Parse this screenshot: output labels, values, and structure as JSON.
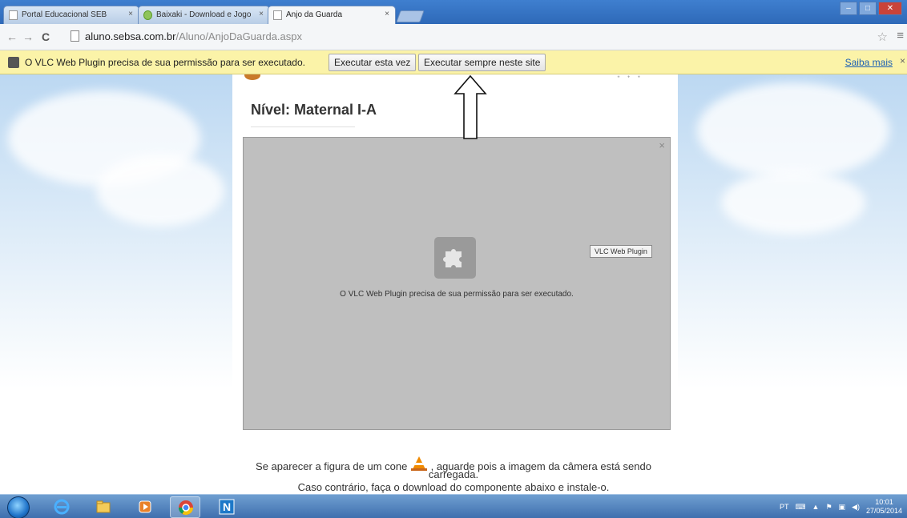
{
  "browser": {
    "tabs": [
      {
        "label": "Portal Educacional SEB",
        "active": false
      },
      {
        "label": "Baixaki - Download e Jogo",
        "active": false
      },
      {
        "label": "Anjo da Guarda",
        "active": true
      }
    ],
    "tab_close": "×",
    "url_host": "aluno.sebsa.com.br",
    "url_path": "/Aluno/AnjoDaGuarda.aspx"
  },
  "infobar": {
    "message": "O VLC Web Plugin precisa de sua permissão para ser executado.",
    "run_once_label": "Executar esta vez",
    "run_always_label": "Executar sempre neste site",
    "learn_more_label": "Saiba mais"
  },
  "page": {
    "level_title": "Nível: Maternal I-A",
    "plugin_tag": "VLC Web Plugin",
    "plugin_message": "O VLC Web Plugin precisa de sua permissão para ser executado.",
    "plugin_close": "×",
    "cone_text_before": "Se aparecer a figura de um cone",
    "cone_text_after": ", aguarde pois a imagem da câmera está sendo",
    "cone_text_line2": "carregada.",
    "download_text": "Caso contrário, faça o download do componente abaixo e instale-o."
  },
  "taskbar": {
    "language": "PT",
    "time": "10:01",
    "date": "27/05/2014"
  },
  "colors": {
    "infobar_bg": "#fbf3a8",
    "link": "#1a5fb4",
    "plugin_bg": "#bfbfbf"
  }
}
